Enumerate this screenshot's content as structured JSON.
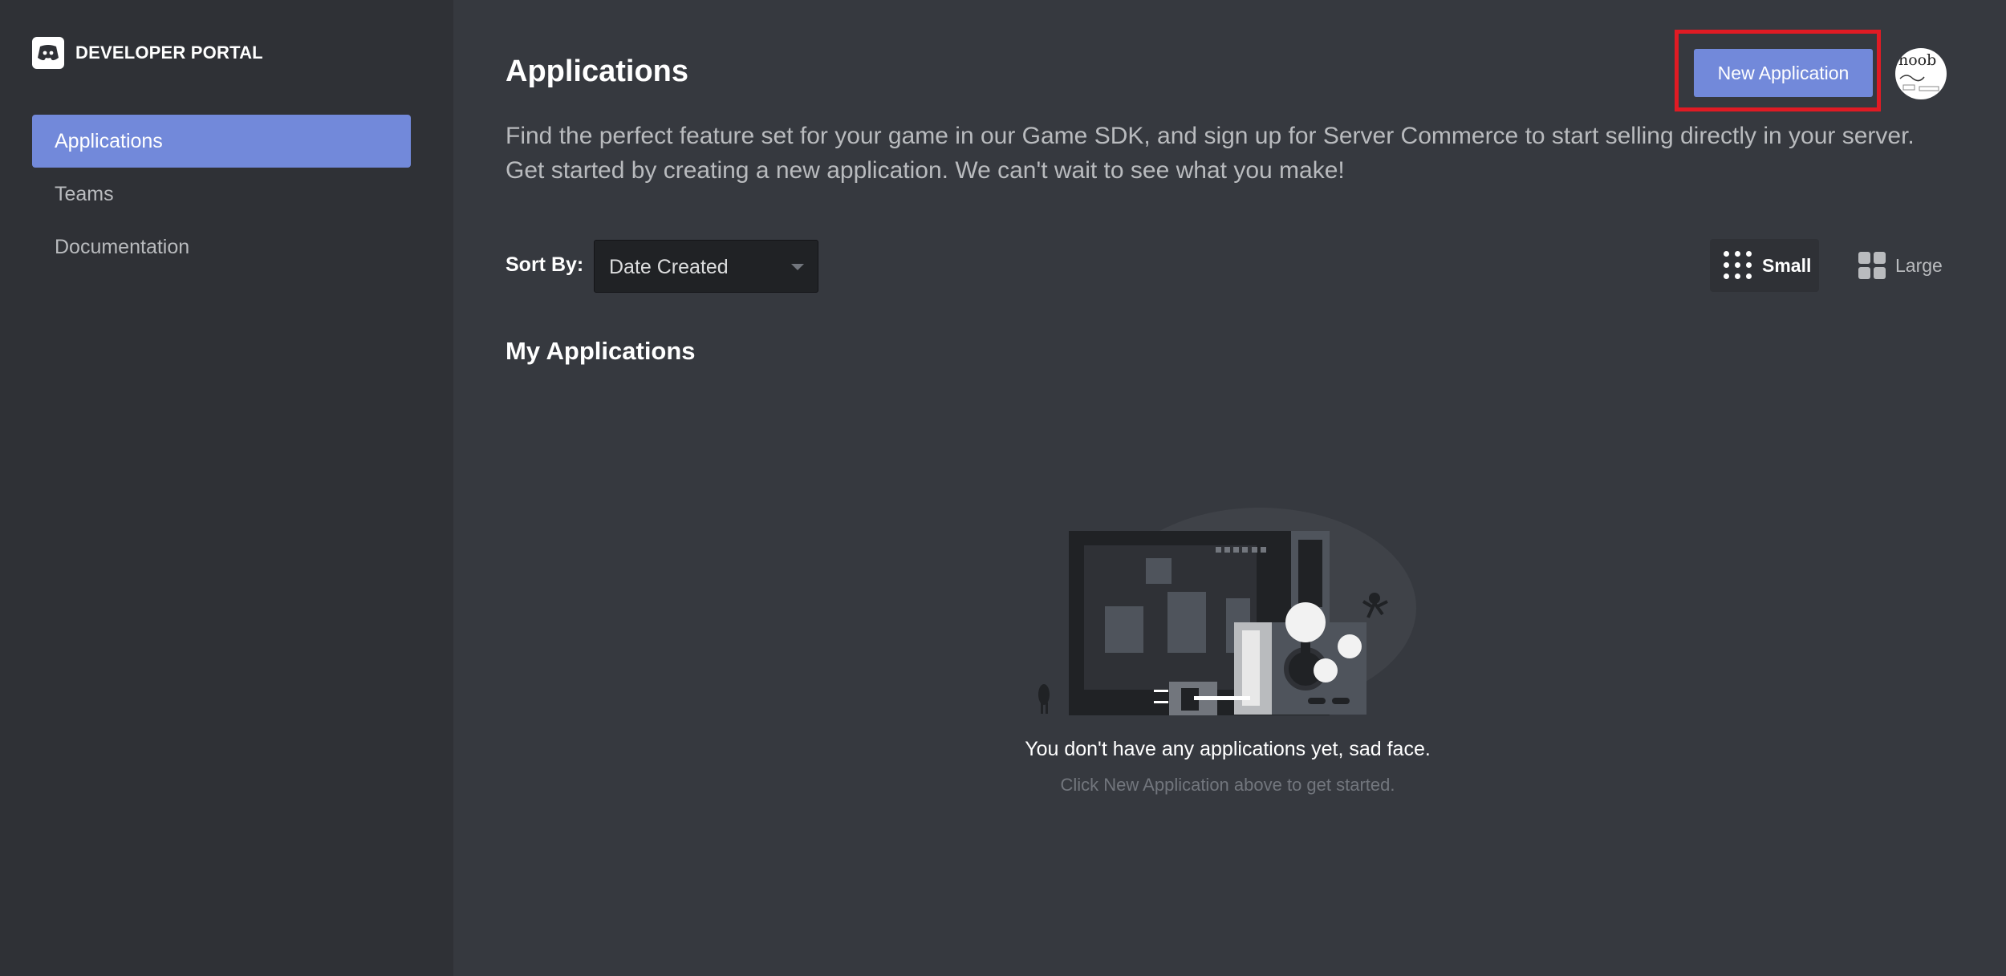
{
  "sidebar": {
    "brand": "DEVELOPER PORTAL",
    "items": [
      {
        "label": "Applications",
        "active": true
      },
      {
        "label": "Teams",
        "active": false
      },
      {
        "label": "Documentation",
        "active": false
      }
    ]
  },
  "header": {
    "title": "Applications",
    "new_app_label": "New Application",
    "avatar_text": "noob"
  },
  "intro": {
    "line1": "Find the perfect feature set for your game in our Game SDK, and sign up for Server Commerce to start selling directly in your server.",
    "line2": "Get started by creating a new application. We can't wait to see what you make!"
  },
  "sort": {
    "label": "Sort By:",
    "selected": "Date Created"
  },
  "view": {
    "small_label": "Small",
    "large_label": "Large",
    "selected": "Small"
  },
  "section": {
    "title": "My Applications"
  },
  "empty_state": {
    "title": "You don't have any applications yet, sad face.",
    "subtitle": "Click New Application above to get started."
  },
  "colors": {
    "accent": "#7289da",
    "highlight": "#e01b24",
    "background": "#36393f",
    "sidebar": "#2f3136"
  }
}
